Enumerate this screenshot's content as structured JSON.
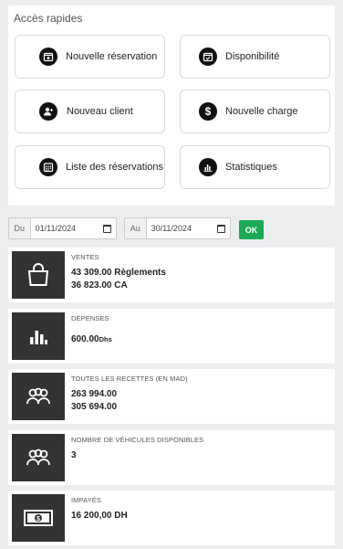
{
  "quick_access": {
    "title": "Accès rapides",
    "buttons": [
      {
        "label": "Nouvelle réservation",
        "icon": "calendar-plus-icon"
      },
      {
        "label": "Disponibilité",
        "icon": "calendar-check-icon"
      },
      {
        "label": "Nouveau client",
        "icon": "user-plus-icon"
      },
      {
        "label": "Nouvelle charge",
        "icon": "dollar-icon"
      },
      {
        "label": "Liste des réservations",
        "icon": "calendar-list-icon"
      },
      {
        "label": "Statistiques",
        "icon": "bar-chart-icon"
      }
    ]
  },
  "filters": {
    "from_label": "Du",
    "from_value": "01/11/2024",
    "to_label": "Au",
    "to_value": "30/11/2024",
    "ok_label": "OK"
  },
  "stats": [
    {
      "title": "Ventes",
      "line1": "43 309.00 Règlements",
      "line2": "36 823.00 CA"
    },
    {
      "title": "Dépenses",
      "line1": "600.00",
      "unit": "Dhs"
    },
    {
      "title": "Toutes les recettes (en MAD)",
      "line1": "263 994.00",
      "line2": "305 694.00"
    },
    {
      "title": "Nombre de véhicules disponibles",
      "line1": "3"
    },
    {
      "title": "Impayés",
      "line1": "16 200,00 DH"
    }
  ],
  "colors": {
    "ok_button": "#1aaa55",
    "icon_box": "#333333",
    "icon_circle": "#111111"
  }
}
